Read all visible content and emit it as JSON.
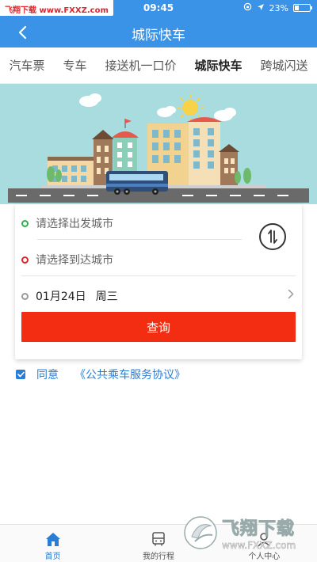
{
  "status_bar": {
    "watermark": "飞翔下载 www.FXXZ.com",
    "time": "09:45",
    "battery": "23%"
  },
  "nav": {
    "title": "城际快车"
  },
  "tabs": [
    {
      "label": "汽车票"
    },
    {
      "label": "专车"
    },
    {
      "label": "接送机一口价"
    },
    {
      "label": "城际快车"
    },
    {
      "label": "跨城闪送"
    }
  ],
  "active_tab": 3,
  "form": {
    "departure_placeholder": "请选择出发城市",
    "arrival_placeholder": "请选择到达城市",
    "date": "01月24日",
    "weekday": "周三",
    "query_label": "查询"
  },
  "agreement": {
    "label": "同意",
    "link": "《公共乘车服务协议》",
    "checked": true
  },
  "tabbar": [
    {
      "label": "首页",
      "icon": "home-icon"
    },
    {
      "label": "我的行程",
      "icon": "bus-icon"
    },
    {
      "label": "个人中心",
      "icon": "user-icon"
    }
  ],
  "watermark": {
    "title": "飞翔下载",
    "url": "www.FXXZ.com"
  },
  "colors": {
    "brand_blue": "#3a93e6",
    "query_red": "#f32d12",
    "link_blue": "#2a7dd6",
    "banner_bg": "#a9dcdf"
  }
}
